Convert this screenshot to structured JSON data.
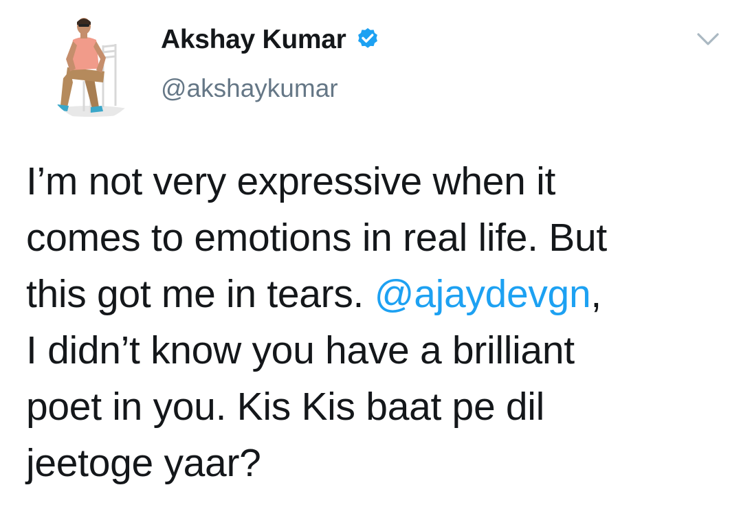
{
  "tweet": {
    "author": {
      "display_name": "Akshay Kumar",
      "handle": "@akshaykumar",
      "verified": true,
      "verified_icon": "verified-badge-icon",
      "avatar": "profile-photo"
    },
    "menu_icon": "chevron-down-icon",
    "text_lines": [
      {
        "before": "I’m not very expressive when it",
        "mention": "",
        "after": ""
      },
      {
        "before": "comes to emotions in real life. But",
        "mention": "",
        "after": ""
      },
      {
        "before": "this got me in tears. ",
        "mention": "@ajaydevgn",
        "after": ","
      },
      {
        "before": "I didn’t know you have a brilliant",
        "mention": "",
        "after": ""
      },
      {
        "before": "poet in you. Kis Kis baat pe dil",
        "mention": "",
        "after": ""
      },
      {
        "before": "jeetoge yaar?",
        "mention": "",
        "after": ""
      }
    ]
  },
  "colors": {
    "text": "#14171a",
    "secondary": "#657786",
    "accent": "#1da1f2",
    "caret": "#aab8c2"
  }
}
